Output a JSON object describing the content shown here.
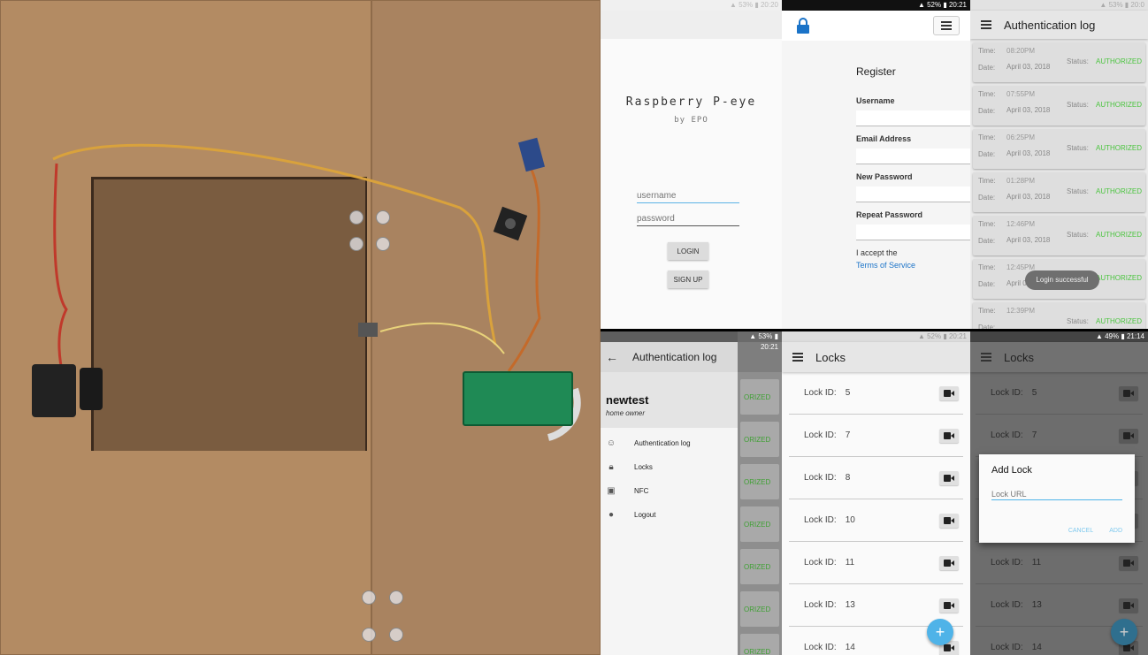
{
  "login": {
    "status": "▲ 53% ▮ 20:20",
    "title": "Raspberry P-eye",
    "subtitle": "by EPO",
    "username_placeholder": "username",
    "password_placeholder": "password",
    "login_label": "LOGIN",
    "signup_label": "SIGN UP"
  },
  "register": {
    "status": "▲ 52% ▮ 20:21",
    "heading": "Register",
    "username_label": "Username",
    "email_label": "Email Address",
    "new_password_label": "New Password",
    "repeat_password_label": "Repeat Password",
    "accept_text": "I accept the",
    "terms_link": "Terms of Service"
  },
  "auth_log": {
    "status": "▲ 53% ▮ 20:0",
    "title": "Authentication log",
    "time_label": "Time:",
    "date_label": "Date:",
    "status_label": "Status:",
    "entries": [
      {
        "time": "08:20PM",
        "date": "April 03, 2018",
        "status": "AUTHORIZED"
      },
      {
        "time": "07:55PM",
        "date": "April 03, 2018",
        "status": "AUTHORIZED"
      },
      {
        "time": "06:25PM",
        "date": "April 03, 2018",
        "status": "AUTHORIZED"
      },
      {
        "time": "01:28PM",
        "date": "April 03, 2018",
        "status": "AUTHORIZED"
      },
      {
        "time": "12:46PM",
        "date": "April 03, 2018",
        "status": "AUTHORIZED"
      },
      {
        "time": "12:45PM",
        "date": "April 03, 2018",
        "status": "AUTHORIZED"
      },
      {
        "time": "12:39PM",
        "date": "",
        "status": "AUTHORIZED"
      }
    ],
    "toast": "Login successful"
  },
  "drawer": {
    "status": "▲ 53% ▮ 20:21",
    "title": "Authentication log",
    "user_name": "newtest",
    "user_role": "home owner",
    "behind_status": [
      "ORIZED",
      "ORIZED",
      "ORIZED",
      "ORIZED",
      "ORIZED",
      "ORIZED",
      "ORIZED"
    ],
    "items": [
      {
        "label": "Authentication log",
        "icon": "face-icon"
      },
      {
        "label": "Locks",
        "icon": "lock-icon"
      },
      {
        "label": "NFC",
        "icon": "nfc-icon"
      },
      {
        "label": "Logout",
        "icon": "person-icon"
      }
    ]
  },
  "locks": {
    "status": "▲ 52% ▮ 20:21",
    "title": "Locks",
    "id_label": "Lock ID:",
    "ids": [
      "5",
      "7",
      "8",
      "10",
      "11",
      "13",
      "14"
    ],
    "fab": "+"
  },
  "add_lock": {
    "status": "▲ 49% ▮ 21:14",
    "title": "Locks",
    "id_label": "Lock ID:",
    "ids": [
      "5",
      "7",
      "8",
      "10",
      "11",
      "13",
      "14"
    ],
    "dialog_title": "Add Lock",
    "url_placeholder": "Lock URL",
    "cancel": "CANCEL",
    "add": "ADD",
    "fab": "+"
  },
  "colors": {
    "accent": "#4fb3e8",
    "authorized": "#4bc43f",
    "lock_icon": "#1a73c8"
  }
}
